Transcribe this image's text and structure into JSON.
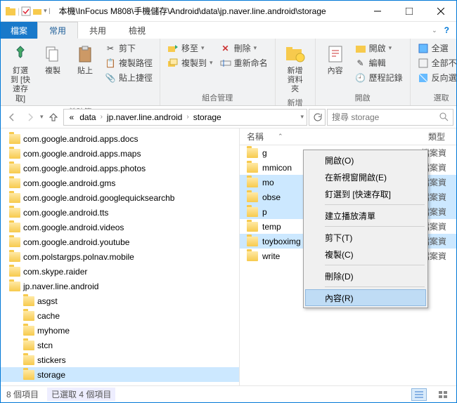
{
  "title": "本機\\InFocus M808\\手機儲存\\Android\\data\\jp.naver.line.android\\storage",
  "tabs": {
    "file": "檔案",
    "home": "常用",
    "share": "共用",
    "view": "檢視"
  },
  "ribbon": {
    "clipboard": {
      "pin": "釘選到 [快速存取]",
      "copy": "複製",
      "paste": "貼上",
      "cut": "剪下",
      "copypath": "複製路徑",
      "pasteshort": "貼上捷徑",
      "label": "剪貼簿"
    },
    "organize": {
      "moveto": "移至",
      "copyto": "複製到",
      "delete": "刪除",
      "rename": "重新命名",
      "label": "組合管理"
    },
    "new": {
      "newfolder": "新增資料夾",
      "label": "新增"
    },
    "open": {
      "props": "內容",
      "open": "開啟",
      "edit": "編輯",
      "history": "歷程記錄",
      "label": "開啟"
    },
    "select": {
      "all": "全選",
      "none": "全部不選",
      "invert": "反向選擇",
      "label": "選取"
    }
  },
  "crumbs": [
    "data",
    "jp.naver.line.android",
    "storage"
  ],
  "search": {
    "placeholder": "搜尋 storage"
  },
  "tree": [
    {
      "d": 0,
      "n": "com.google.android.apps.docs"
    },
    {
      "d": 0,
      "n": "com.google.android.apps.maps"
    },
    {
      "d": 0,
      "n": "com.google.android.apps.photos"
    },
    {
      "d": 0,
      "n": "com.google.android.gms"
    },
    {
      "d": 0,
      "n": "com.google.android.googlequicksearchb"
    },
    {
      "d": 0,
      "n": "com.google.android.tts"
    },
    {
      "d": 0,
      "n": "com.google.android.videos"
    },
    {
      "d": 0,
      "n": "com.google.android.youtube"
    },
    {
      "d": 0,
      "n": "com.polstargps.polnav.mobile"
    },
    {
      "d": 0,
      "n": "com.skype.raider"
    },
    {
      "d": 0,
      "n": "jp.naver.line.android"
    },
    {
      "d": 1,
      "n": "asgst"
    },
    {
      "d": 1,
      "n": "cache"
    },
    {
      "d": 1,
      "n": "myhome"
    },
    {
      "d": 1,
      "n": "stcn"
    },
    {
      "d": 1,
      "n": "stickers"
    },
    {
      "d": 1,
      "n": "storage",
      "sel": true
    }
  ],
  "listhdr": {
    "name": "名稱",
    "type": "類型"
  },
  "list": [
    {
      "n": "g",
      "sel": false
    },
    {
      "n": "mmicon",
      "sel": false
    },
    {
      "n": "mo",
      "sel": true
    },
    {
      "n": "obse",
      "sel": true
    },
    {
      "n": "p",
      "sel": true
    },
    {
      "n": "temp",
      "sel": false
    },
    {
      "n": "toyboximg",
      "sel": true
    },
    {
      "n": "write",
      "sel": false
    }
  ],
  "typetext": "檔案資",
  "ctx": {
    "open": "開啟(O)",
    "newwin": "在新視窗開啟(E)",
    "pin": "釘選到 [快速存取]",
    "playlist": "建立播放清單",
    "cut": "剪下(T)",
    "copy": "複製(C)",
    "delete": "刪除(D)",
    "props": "內容(R)"
  },
  "status": {
    "count": "8 個項目",
    "selected": "已選取 4 個項目"
  }
}
